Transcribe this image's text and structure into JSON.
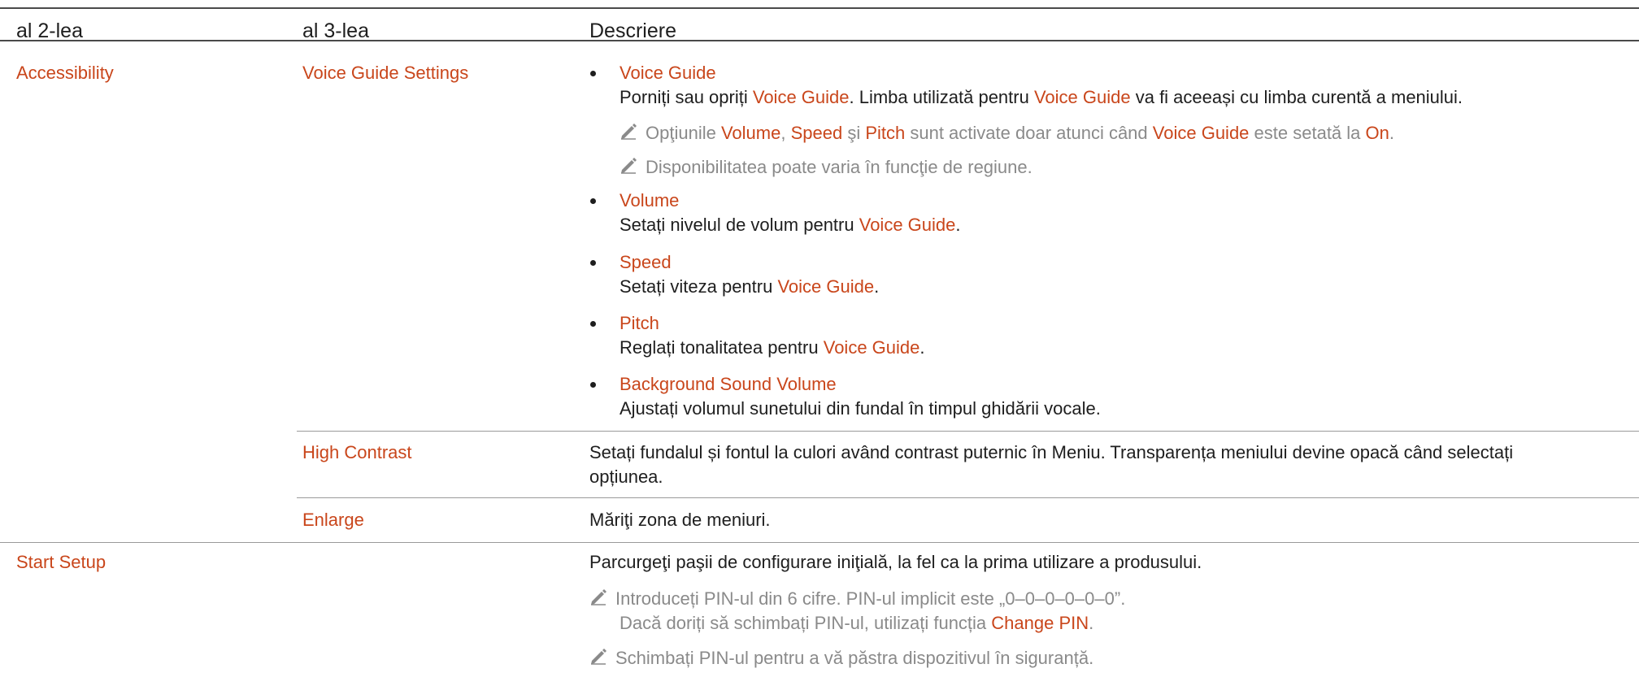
{
  "header": {
    "col2": "al 2-lea",
    "col3": "al 3-lea",
    "col4": "Descriere"
  },
  "accent_color": "#c9461b",
  "note_icon": "pencil-note-icon",
  "accessibility": {
    "label": "Accessibility",
    "voice_guide_settings": "Voice Guide Settings",
    "vg": {
      "title": "Voice Guide",
      "d1": "Porniți sau opriți ",
      "d_term": "Voice Guide",
      "d2": ". Limba utilizată pentru ",
      "d_term2": "Voice Guide",
      "d3": " va fi aceeași cu limba curentă a meniului."
    },
    "note1": {
      "a": "Opţiunile ",
      "volume": "Volume",
      "b": ", ",
      "speed": "Speed",
      "c": " şi ",
      "pitch": "Pitch",
      "d": " sunt activate doar atunci când ",
      "vg": "Voice Guide",
      "e": " este setată la ",
      "on": "On",
      "f": "."
    },
    "note2": "Disponibilitatea poate varia în funcţie de regiune.",
    "volume": {
      "title": "Volume",
      "d": "Setați nivelul de volum pentru ",
      "term": "Voice Guide",
      "end": "."
    },
    "speed": {
      "title": "Speed",
      "d": "Setați viteza pentru ",
      "term": "Voice Guide",
      "end": "."
    },
    "pitch": {
      "title": "Pitch",
      "d": "Reglați tonalitatea pentru ",
      "term": "Voice Guide",
      "end": "."
    },
    "bgsound": {
      "title": "Background Sound Volume",
      "d": "Ajustați volumul sunetului din fundal în timpul ghidării vocale."
    },
    "high_contrast": {
      "label": "High Contrast",
      "d1": "Setați fundalul și fontul la culori având contrast puternic în Meniu. Transparența meniului devine opacă când selectați",
      "d2": "opțiunea."
    },
    "enlarge": {
      "label": "Enlarge",
      "d": "Măriţi zona de meniuri."
    }
  },
  "start_setup": {
    "label": "Start Setup",
    "d": "Parcurgeţi paşii de configurare iniţială, la fel ca la prima utilizare a produsului.",
    "note1a": "Introduceți PIN-ul din 6 cifre. PIN-ul implicit este „0–0–0–0–0–0”.",
    "note1b": "Dacă doriți să schimbați PIN-ul, utilizați funcția ",
    "change_pin": "Change PIN",
    "note1c": ".",
    "note2": "Schimbați PIN-ul pentru a vă păstra dispozitivul în siguranță."
  }
}
